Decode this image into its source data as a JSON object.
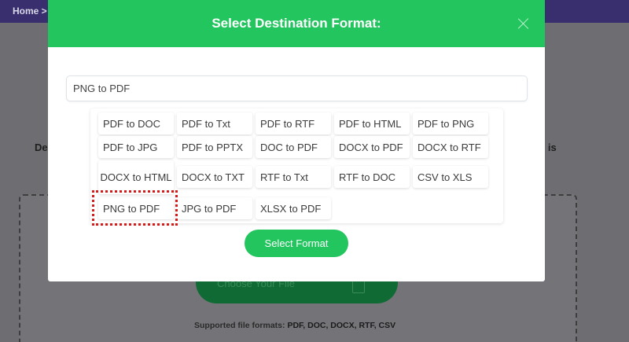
{
  "breadcrumb": {
    "home": "Home >"
  },
  "background": {
    "side_text_left": "De",
    "side_text_right": "e is",
    "choose_file_label": "Choose Your File",
    "supported_prefix": "Supported file formats:",
    "supported_list": "PDF, DOC, DOCX, RTF, CSV"
  },
  "modal": {
    "title": "Select Destination Format:",
    "search_value": "PNG to PDF",
    "formats": [
      [
        "PDF to DOC",
        "PDF to Txt",
        "PDF to RTF",
        "PDF to HTML",
        "PDF to PNG"
      ],
      [
        "PDF to JPG",
        "PDF to PPTX",
        "DOC to PDF",
        "DOCX to PDF",
        "DOCX to RTF"
      ],
      [
        "DOCX to HTML",
        "DOCX to TXT",
        "RTF to Txt",
        "RTF to DOC",
        "CSV to XLS"
      ],
      [
        "PNG to PDF",
        "JPG to PDF",
        "XLSX to PDF"
      ]
    ],
    "highlighted_format": "PNG to PDF",
    "select_button": "Select Format"
  },
  "colors": {
    "accent": "#22c55e",
    "highlight": "#d51a1a"
  }
}
